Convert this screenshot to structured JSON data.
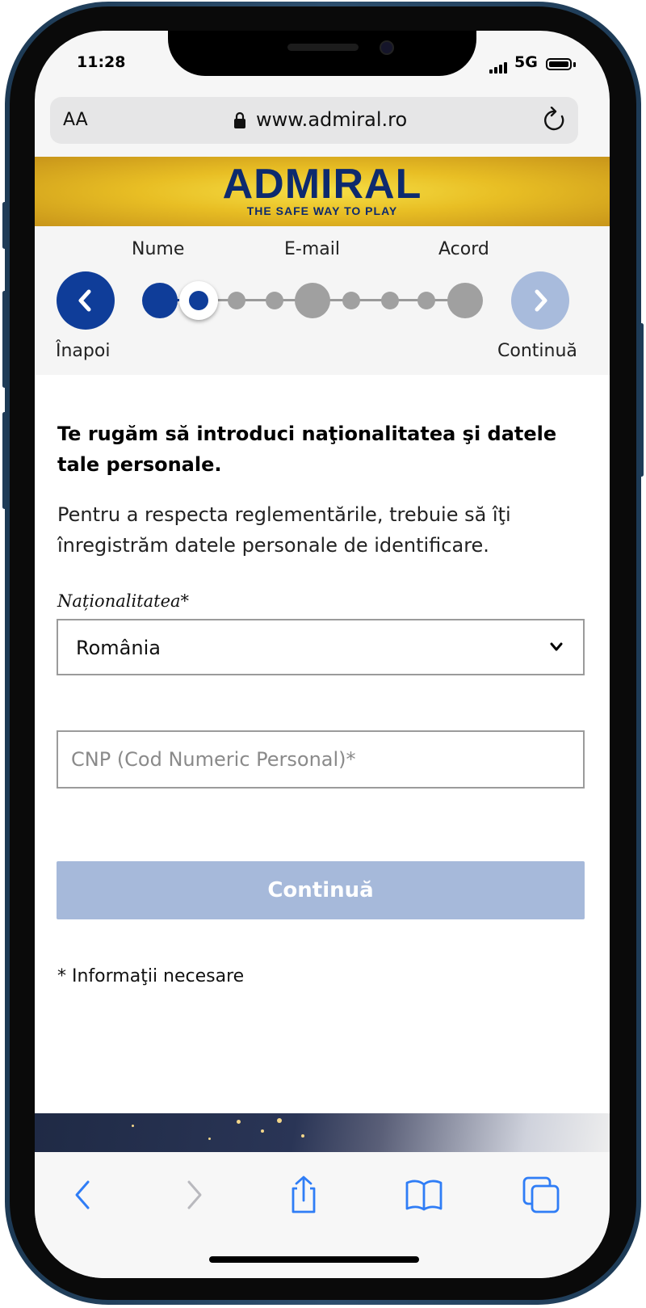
{
  "status_bar": {
    "time": "11:28",
    "network": "5G"
  },
  "browser": {
    "text_size_label": "AA",
    "url": "www.admiral.ro"
  },
  "banner": {
    "logo": "ADMIRAL",
    "tagline": "THE SAFE WAY TO PLAY"
  },
  "stepper": {
    "steps": [
      "Nume",
      "E-mail",
      "Acord"
    ],
    "back_label": "Înapoi",
    "next_label": "Continuă",
    "current_step": 2,
    "total_dots": 9
  },
  "form": {
    "title": "Te rugăm să introduci naţionalitatea şi datele tale personale.",
    "description": "Pentru a respecta reglementările, trebuie să îţi înregistrăm datele personale de identificare.",
    "nationality_label": "Naționalitatea*",
    "nationality_value": "România",
    "cnp_placeholder": "CNP (Cod Numeric Personal)*",
    "submit_label": "Continuă",
    "required_note": "* Informaţii necesare"
  },
  "colors": {
    "brand_blue": "#0f3d99",
    "disabled_blue": "#a6b9da",
    "banner_gold": "#e8be24",
    "ios_blue": "#2f7df6"
  },
  "toolbar": {
    "icons": [
      "back-icon",
      "forward-icon",
      "share-icon",
      "bookmarks-icon",
      "tabs-icon"
    ]
  }
}
